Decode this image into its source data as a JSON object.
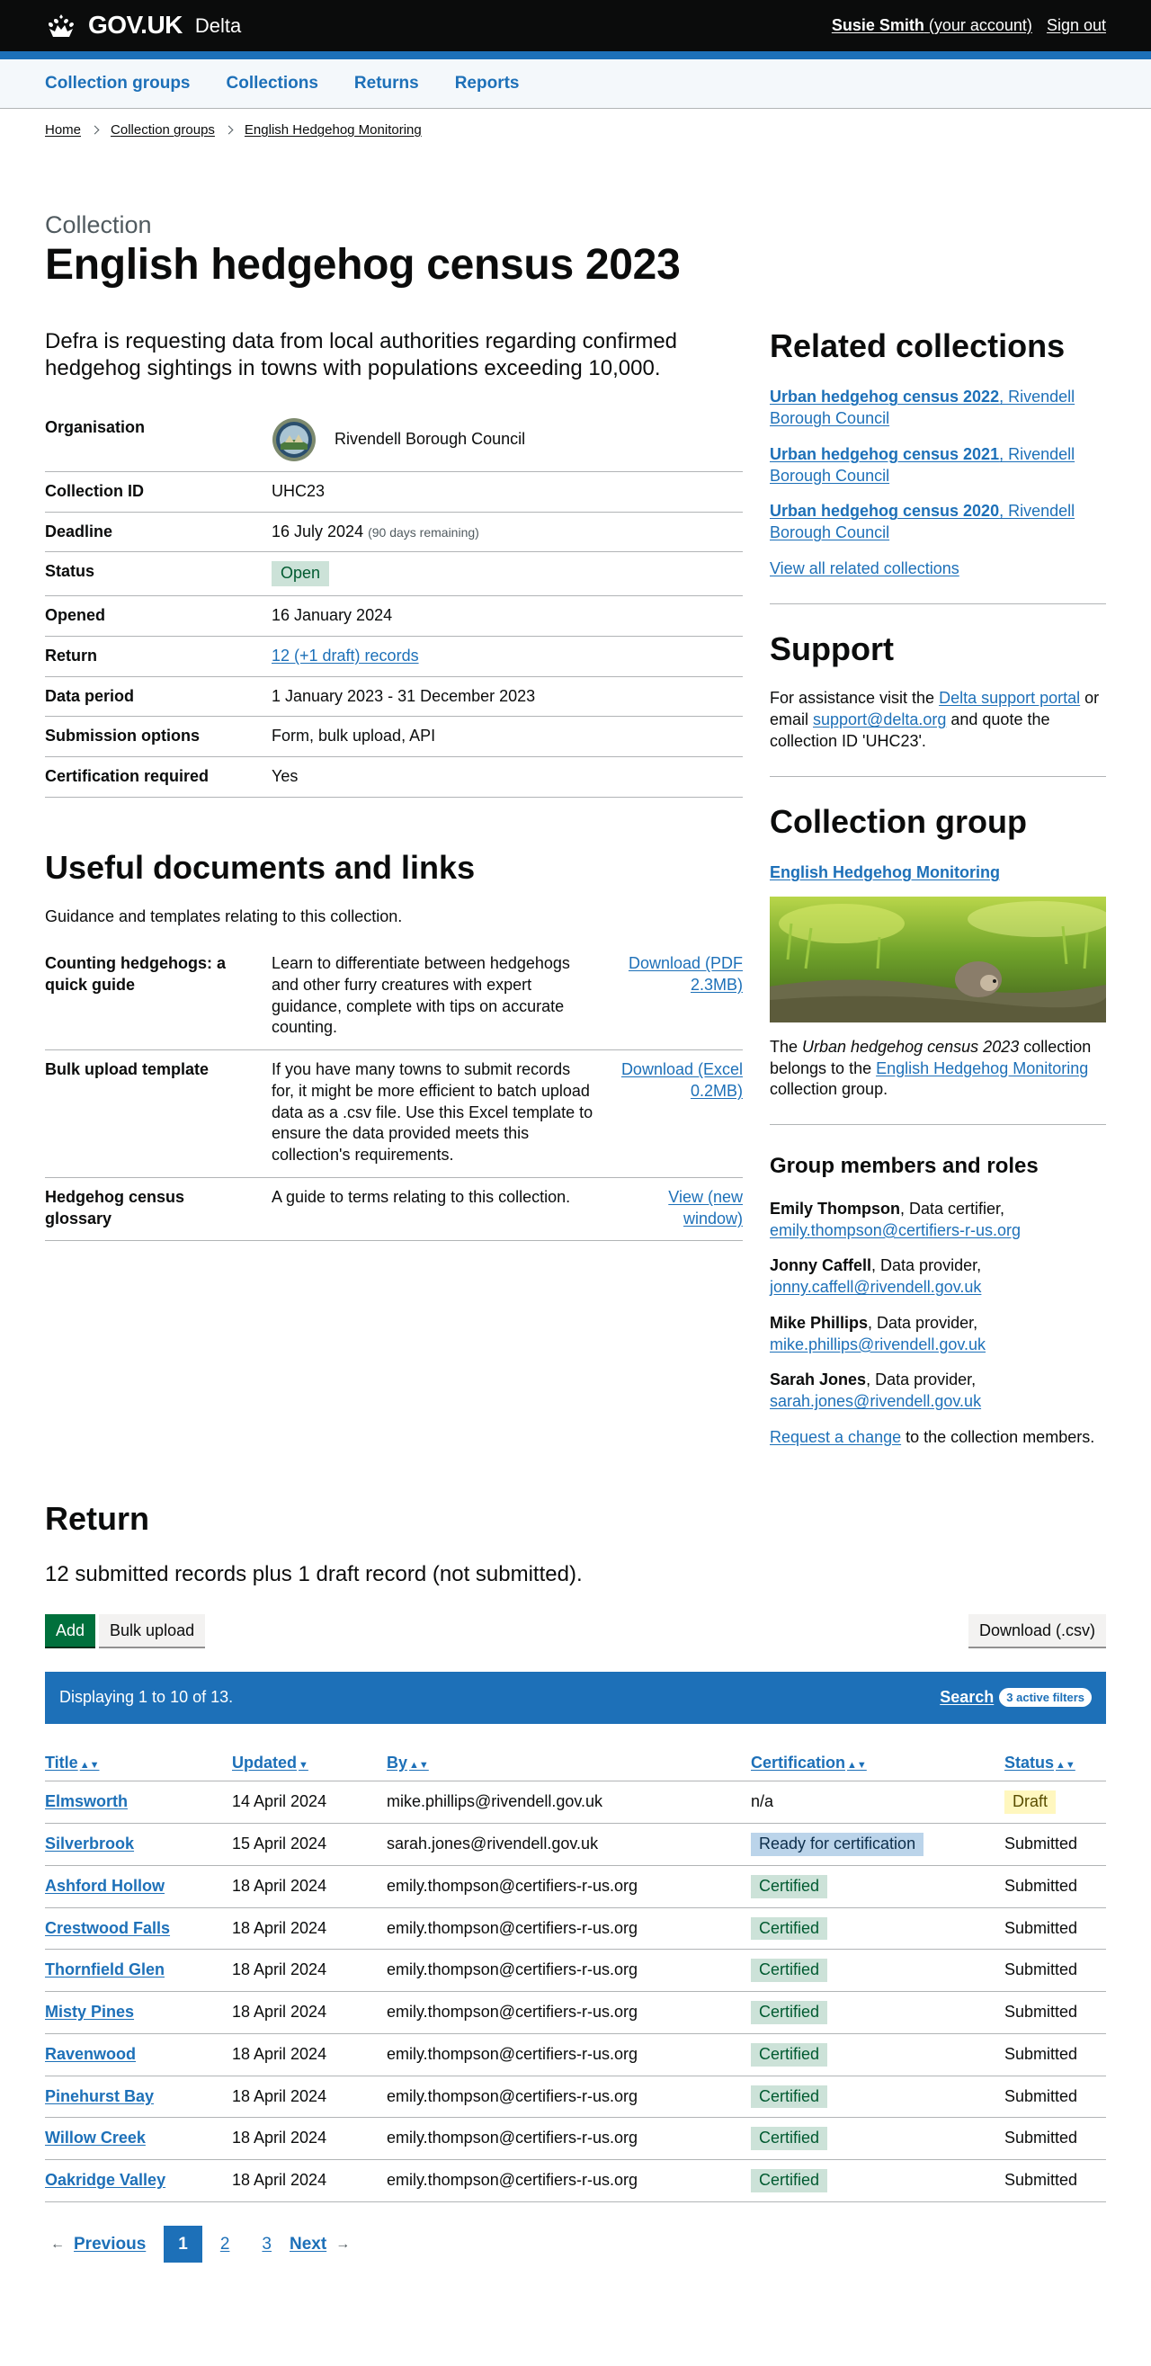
{
  "header": {
    "logo": "GOV.UK",
    "service": "Delta",
    "user_name": "Susie Smith",
    "user_suffix": "(your account)",
    "sign_out": "Sign out"
  },
  "nav": {
    "items": [
      "Collection groups",
      "Collections",
      "Returns",
      "Reports"
    ]
  },
  "breadcrumb": [
    "Home",
    "Collection groups",
    "English Hedgehog Monitoring"
  ],
  "page": {
    "caption": "Collection",
    "title": "English hedgehog census 2023",
    "lead": "Defra is requesting data from local authorities regarding confirmed hedgehog sightings in towns with populations exceeding 10,000."
  },
  "summary": {
    "organisation_key": "Organisation",
    "organisation": "Rivendell Borough Council",
    "id_key": "Collection ID",
    "id": "UHC23",
    "deadline_key": "Deadline",
    "deadline": "16 July 2024",
    "deadline_note": "(90 days remaining)",
    "status_key": "Status",
    "status": "Open",
    "opened_key": "Opened",
    "opened": "16 January 2024",
    "return_key": "Return",
    "return": "12 (+1 draft) records",
    "period_key": "Data period",
    "period": "1 January 2023 - 31 December 2023",
    "options_key": "Submission options",
    "options": "Form, bulk upload, API",
    "cert_key": "Certification required",
    "cert": "Yes"
  },
  "docs": {
    "heading": "Useful documents and links",
    "intro": "Guidance and templates relating to this collection.",
    "items": [
      {
        "title": "Counting hedgehogs: a quick guide",
        "desc": "Learn to differentiate between hedgehogs and other furry creatures with expert guidance, complete with tips on accurate counting.",
        "action": "Download (PDF 2.3MB)"
      },
      {
        "title": "Bulk upload template",
        "desc": "If you have many towns to submit records for, it might be more efficient to batch upload data as a .csv file. Use this Excel template to ensure the data provided meets this collection's requirements.",
        "action": "Download (Excel 0.2MB)"
      },
      {
        "title": "Hedgehog census glossary",
        "desc": "A guide to terms relating to this collection.",
        "action": "View (new window)"
      }
    ]
  },
  "related": {
    "heading": "Related collections",
    "items": [
      {
        "name": "Urban hedgehog census 2022",
        "org": ", Rivendell Borough Council"
      },
      {
        "name": "Urban hedgehog census 2021",
        "org": ", Rivendell Borough Council"
      },
      {
        "name": "Urban hedgehog census 2020",
        "org": ", Rivendell Borough Council"
      }
    ],
    "view_all": "View all related collections"
  },
  "support": {
    "heading": "Support",
    "t1": "For assistance visit the ",
    "portal": "Delta support portal",
    "t2": " or email ",
    "email": "support@delta.org",
    "t3": " and quote the collection ID 'UHC23'."
  },
  "group": {
    "heading": "Collection group",
    "link": "English Hedgehog Monitoring",
    "t1": "The ",
    "em": "Urban hedgehog census 2023",
    "t2": " collection belongs to the ",
    "link2": "English Hedgehog Monitoring",
    "t3": " collection group."
  },
  "members": {
    "heading": "Group members and roles",
    "items": [
      {
        "name": "Emily Thompson",
        "role": ", Data certifier,",
        "email": "emily.thompson@certifiers-r-us.org"
      },
      {
        "name": "Jonny Caffell",
        "role": ", Data provider,",
        "email": "jonny.caffell@rivendell.gov.uk"
      },
      {
        "name": "Mike Phillips",
        "role": ", Data provider,",
        "email": "mike.phillips@rivendell.gov.uk"
      },
      {
        "name": "Sarah Jones",
        "role": ", Data provider,",
        "email": "sarah.jones@rivendell.gov.uk"
      }
    ],
    "request_link": "Request a change",
    "request_rest": " to the collection members."
  },
  "return": {
    "heading": "Return",
    "lead": "12 submitted records plus 1 draft record (not submitted).",
    "add": "Add",
    "bulk": "Bulk upload",
    "download": "Download (.csv)",
    "displaying": "Displaying 1 to 10 of 13.",
    "search": "Search",
    "filters": "3 active filters",
    "columns": [
      "Title",
      "Updated",
      "By",
      "Certification",
      "Status"
    ],
    "sort_icons": [
      "▲▼",
      "▼",
      "▲▼",
      "▲▼",
      "▲▼"
    ],
    "rows": [
      {
        "title": "Elmsworth",
        "updated": "14 April 2024",
        "by": "mike.phillips@rivendell.gov.uk",
        "cert": "n/a",
        "cert_tag": "",
        "status": "Draft",
        "status_tag": "draft"
      },
      {
        "title": "Silverbrook",
        "updated": "15 April 2024",
        "by": "sarah.jones@rivendell.gov.uk",
        "cert": "Ready for certification",
        "cert_tag": "ready",
        "status": "Submitted",
        "status_tag": ""
      },
      {
        "title": "Ashford Hollow",
        "updated": "18 April 2024",
        "by": "emily.thompson@certifiers-r-us.org",
        "cert": "Certified",
        "cert_tag": "cert",
        "status": "Submitted",
        "status_tag": ""
      },
      {
        "title": "Crestwood Falls",
        "updated": "18 April 2024",
        "by": "emily.thompson@certifiers-r-us.org",
        "cert": "Certified",
        "cert_tag": "cert",
        "status": "Submitted",
        "status_tag": ""
      },
      {
        "title": "Thornfield Glen",
        "updated": "18 April 2024",
        "by": "emily.thompson@certifiers-r-us.org",
        "cert": "Certified",
        "cert_tag": "cert",
        "status": "Submitted",
        "status_tag": ""
      },
      {
        "title": "Misty Pines",
        "updated": "18 April 2024",
        "by": "emily.thompson@certifiers-r-us.org",
        "cert": "Certified",
        "cert_tag": "cert",
        "status": "Submitted",
        "status_tag": ""
      },
      {
        "title": "Ravenwood",
        "updated": "18 April 2024",
        "by": "emily.thompson@certifiers-r-us.org",
        "cert": "Certified",
        "cert_tag": "cert",
        "status": "Submitted",
        "status_tag": ""
      },
      {
        "title": "Pinehurst Bay",
        "updated": "18 April 2024",
        "by": "emily.thompson@certifiers-r-us.org",
        "cert": "Certified",
        "cert_tag": "cert",
        "status": "Submitted",
        "status_tag": ""
      },
      {
        "title": "Willow Creek",
        "updated": "18 April 2024",
        "by": "emily.thompson@certifiers-r-us.org",
        "cert": "Certified",
        "cert_tag": "cert",
        "status": "Submitted",
        "status_tag": ""
      },
      {
        "title": "Oakridge Valley",
        "updated": "18 April 2024",
        "by": "emily.thompson@certifiers-r-us.org",
        "cert": "Certified",
        "cert_tag": "cert",
        "status": "Submitted",
        "status_tag": ""
      }
    ]
  },
  "pagination": {
    "prev": "Previous",
    "pages": [
      "1",
      "2",
      "3"
    ],
    "current": "1",
    "next": "Next"
  },
  "colors": {
    "black": "#0b0c0c",
    "link": "#1d70b8",
    "green": "#00703c",
    "border": "#b1b4b6",
    "nav_bg": "#f4f8fb"
  }
}
